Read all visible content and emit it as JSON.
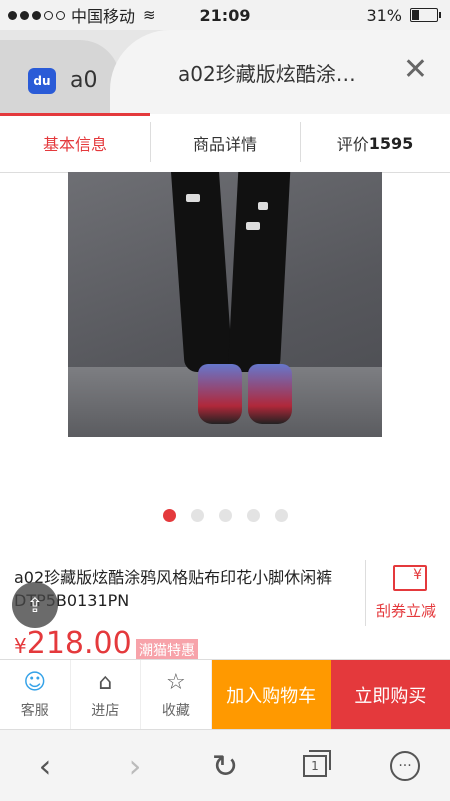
{
  "status": {
    "carrier": "中国移动",
    "time": "21:09",
    "battery": "31%",
    "battery_level": 0.31
  },
  "browser_tabs": {
    "inactive_tab_text": "a0",
    "inactive_tab_logo": "du",
    "active_tab_title": "a02珍藏版炫酷涂…",
    "close_icon": "close-icon"
  },
  "segments": {
    "basic": "基本信息",
    "details": "商品详情",
    "reviews_label": "评价",
    "reviews_count": "1595"
  },
  "gallery": {
    "total_images": 5,
    "current_index": 0
  },
  "product": {
    "title": "a02珍藏版炫酷涂鸦风格贴布印花小脚休闲裤 DTP5B0131PN",
    "currency": "¥",
    "price": "218.00",
    "badge": "潮猫特惠"
  },
  "coupon": {
    "icon_text": "¥",
    "label": "刮券立减"
  },
  "actions": {
    "service": "客服",
    "shop": "进店",
    "favorite": "收藏",
    "add_to_cart": "加入购物车",
    "buy_now": "立即购买"
  },
  "toolbar": {
    "tab_count": "1"
  },
  "colors": {
    "accent": "#e4393c",
    "cart": "#ff9900",
    "service_icon": "#35a2e8"
  }
}
